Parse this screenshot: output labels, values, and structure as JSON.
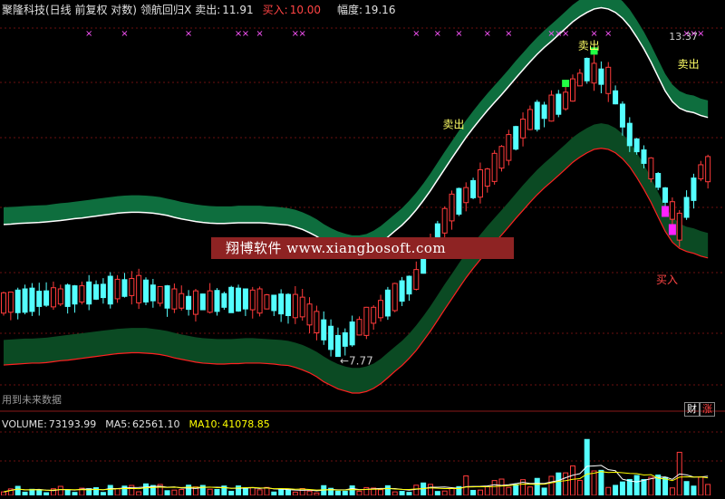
{
  "header": {
    "stock": "聚隆科技(日线 前复权 对数)",
    "indicator": "领航回归X",
    "sell_label": "卖出:",
    "sell_value": "11.91",
    "buy_label": "买入:",
    "buy_value": "10.00",
    "range_label": "幅度:",
    "range_value": "19.16"
  },
  "time_label": "13:37",
  "watermark": "翔博软件 www.xiangbosoft.com",
  "future_data_note": "用到未来数据",
  "badges": {
    "left": "财",
    "right": "涨"
  },
  "volume_header": {
    "vol_label": "VOLUME:",
    "vol_value": "73193.99",
    "ma5_label": "MA5:",
    "ma5_value": "62561.10",
    "ma10_label": "MA10:",
    "ma10_value": "41078.85"
  },
  "annotations": [
    {
      "text": "卖出",
      "x_index": 63,
      "price": 14.3,
      "color": "#ffff66"
    },
    {
      "text": "卖出",
      "x_index": 82,
      "price": 17.8,
      "color": "#ffff66"
    },
    {
      "text": "卖出",
      "x_index": 96,
      "price": 16.9,
      "color": "#ffff66"
    },
    {
      "text": "买入",
      "x_index": 93,
      "price": 9.3,
      "color": "#ff4444"
    },
    {
      "text": "7.77",
      "x_index": 47,
      "price": 7.77,
      "color": "#cccccc"
    }
  ],
  "colors": {
    "up": "#ff3b3b",
    "down": "#54ffff",
    "upper_band": "#0e6e3e",
    "lower_band": "#0b4a23",
    "band_edge": "#ffffff",
    "lower_edge": "#ff2020",
    "ma5": "#ffffff",
    "ma10": "#ffff00",
    "signal_sell": "#22ff44",
    "signal_buy": "#ff22ff",
    "grid": "#6b1010"
  },
  "chart_data": [
    {
      "type": "candlestick",
      "price_range": [
        7.0,
        19.5
      ],
      "log_scale": true,
      "grid": "dashed horizontal",
      "candles": [],
      "upper_band": [],
      "lower_band": []
    },
    {
      "type": "bar",
      "series": []
    }
  ]
}
